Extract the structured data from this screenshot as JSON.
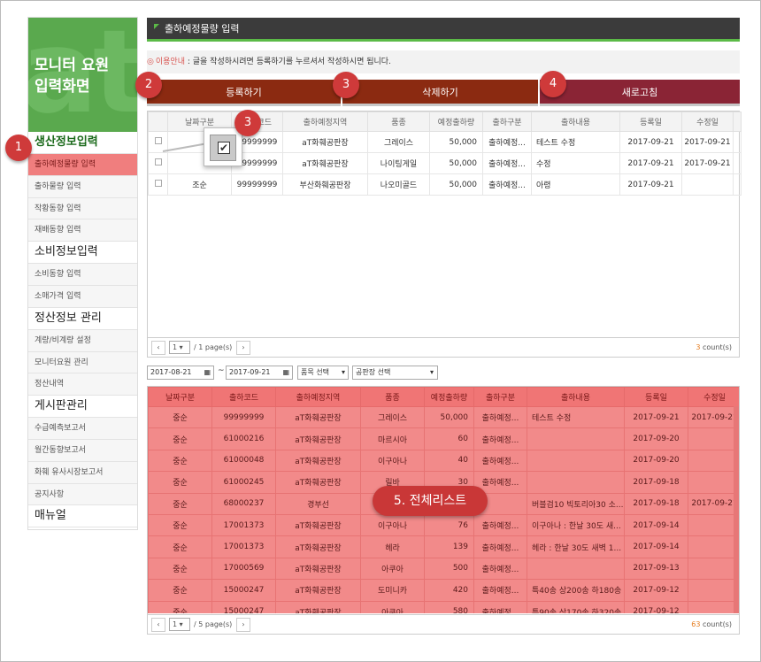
{
  "sidebar": {
    "logo_title": "모니터 요원\n입력화면",
    "items": [
      {
        "label": "생산정보입력",
        "type": "head-green"
      },
      {
        "label": "출하예정물량 입력",
        "type": "active"
      },
      {
        "label": "출하물량 입력",
        "type": "item"
      },
      {
        "label": "작황동향 입력",
        "type": "item"
      },
      {
        "label": "재배동향 입력",
        "type": "item"
      },
      {
        "label": "소비정보입력",
        "type": "head"
      },
      {
        "label": "소비동향 입력",
        "type": "item"
      },
      {
        "label": "소매가격 입력",
        "type": "item"
      },
      {
        "label": "정산정보 관리",
        "type": "head"
      },
      {
        "label": "계량/비계량 설정",
        "type": "item"
      },
      {
        "label": "모니터요원 관리",
        "type": "item"
      },
      {
        "label": "정산내역",
        "type": "item"
      },
      {
        "label": "게시판관리",
        "type": "head"
      },
      {
        "label": "수급예측보고서",
        "type": "item"
      },
      {
        "label": "월간동향보고서",
        "type": "item"
      },
      {
        "label": "화훼 유사시장보고서",
        "type": "item"
      },
      {
        "label": "공지사항",
        "type": "item"
      },
      {
        "label": "매뉴얼",
        "type": "head"
      }
    ]
  },
  "header": {
    "title": "출하예정물량 입력"
  },
  "notice": {
    "icon": "◎",
    "label": "이용안내",
    "text": " : 글을 작성하시려면 등록하기를 누르셔서 작성하시면 됩니다."
  },
  "buttons": {
    "register": "등록하기",
    "delete": "삭제하기",
    "refresh": "새로고침"
  },
  "columns": [
    "날짜구분",
    "출하코드",
    "출하예정지역",
    "품종",
    "예정출하량",
    "출하구분",
    "출하내용",
    "등록일",
    "수정일"
  ],
  "upper_rows": [
    [
      "",
      "99999999",
      "aT화훼공판장",
      "그레이스",
      "50,000",
      "출하예정...",
      "테스트 수정",
      "2017-09-21",
      "2017-09-21"
    ],
    [
      "",
      "99999999",
      "aT화훼공판장",
      "나이팅게일",
      "50,000",
      "출하예정...",
      "수정",
      "2017-09-21",
      "2017-09-21"
    ],
    [
      "조순",
      "99999999",
      "부산화훼공판장",
      "나오미골드",
      "50,000",
      "출하예정...",
      "아령",
      "2017-09-21",
      ""
    ]
  ],
  "upper_pager": {
    "page": "1",
    "pages": "/ 1 page(s)",
    "count_num": "3",
    "count_label": " count(s)"
  },
  "filters": {
    "date_from": "2017-08-21",
    "date_to": "2017-09-21",
    "dash": "~",
    "product": "품목 선택",
    "market": "공판장 선택"
  },
  "lower_rows": [
    [
      "중순",
      "99999999",
      "aT화훼공판장",
      "그레이스",
      "50,000",
      "출하예정...",
      "테스트 수정",
      "2017-09-21",
      "2017-09-21"
    ],
    [
      "중순",
      "61000216",
      "aT화훼공판장",
      "마르시아",
      "60",
      "출하예정...",
      "",
      "2017-09-20",
      ""
    ],
    [
      "중순",
      "61000048",
      "aT화훼공판장",
      "이구아나",
      "40",
      "출하예정...",
      "",
      "2017-09-20",
      ""
    ],
    [
      "중순",
      "61000245",
      "aT화훼공판장",
      "릴바",
      "30",
      "출하예정...",
      "",
      "2017-09-18",
      ""
    ],
    [
      "중순",
      "68000237",
      "경부선",
      "그린",
      "",
      "",
      "버블검10 빅토리아30 소...",
      "2017-09-18",
      "2017-09-21"
    ],
    [
      "중순",
      "17001373",
      "aT화훼공판장",
      "이구아나",
      "76",
      "출하예정...",
      "이구아나 : 한날 30도 새...",
      "2017-09-14",
      ""
    ],
    [
      "중순",
      "17001373",
      "aT화훼공판장",
      "헤라",
      "139",
      "출하예정...",
      "헤라 : 한날 30도 새벽 1...",
      "2017-09-14",
      ""
    ],
    [
      "중순",
      "17000569",
      "aT화훼공판장",
      "아쿠아",
      "500",
      "출하예정...",
      "",
      "2017-09-13",
      ""
    ],
    [
      "중순",
      "15000247",
      "aT화훼공판장",
      "도미니카",
      "420",
      "출하예정...",
      "특40송 상200송 하180송",
      "2017-09-12",
      ""
    ],
    [
      "중순",
      "15000247",
      "aT화훼공판장",
      "아쿠아",
      "580",
      "출하예정...",
      "특90송 상170송 하320송",
      "2017-09-12",
      ""
    ]
  ],
  "lower_pager": {
    "page": "1",
    "pages": "/ 5 page(s)",
    "count_num": "63",
    "count_label": " count(s)"
  },
  "annotations": {
    "b1": "1",
    "b2": "2",
    "b3": "3",
    "b3b": "3",
    "b4": "4",
    "pill": "5. 전체리스트"
  },
  "colors": {
    "green": "#5bba47",
    "btn_dark_red": "#8b2a11",
    "btn_wine": "#8a2435",
    "highlight": "#f28a8a",
    "badge": "#cf3a3a"
  }
}
